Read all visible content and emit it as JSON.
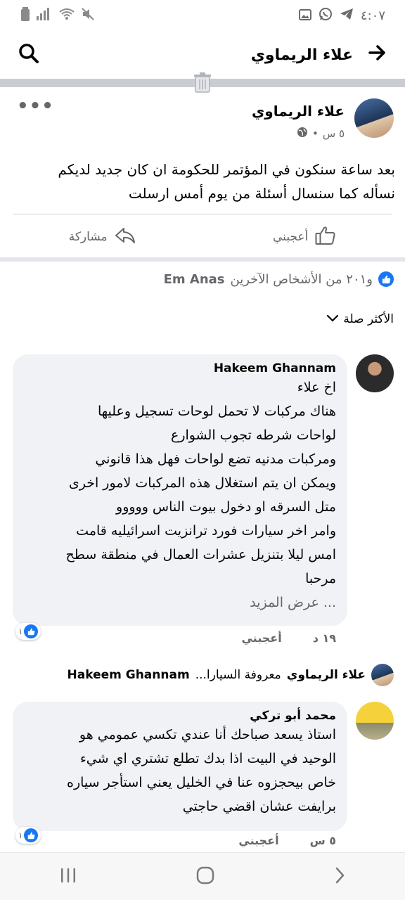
{
  "status_bar": {
    "time": "٤:٠٧",
    "left_icons": [
      "battery-icon",
      "signal-icon",
      "wifi-icon",
      "mute-icon"
    ],
    "right_icons": [
      "gallery-icon",
      "whatsapp-icon",
      "telegram-icon"
    ]
  },
  "header": {
    "title": "علاء الريماوي"
  },
  "post": {
    "author": "علاء الريماوي",
    "time": "٥ س",
    "dot": "•",
    "text_line1": "بعد ساعة سنكون في المؤتمر للحكومة ان كان جديد لديكم",
    "text_line2": "نسأله كما سنسال أسئلة من يوم أمس ارسلت",
    "more": "•••",
    "like_label": "أعجبني",
    "share_label": "مشاركة"
  },
  "reactions": {
    "names": "Em Anas",
    "others": "و٢٠١ من الأشخاص الآخرين"
  },
  "sort": {
    "label": "الأكثر صلة"
  },
  "comments": [
    {
      "name": "Hakeem Ghannam",
      "text": "اخ علاء\nهناك مركبات لا تحمل لوحات  تسجيل وعليها\nلواحات شرطه تجوب الشوارع\nومركبات مدنيه تضع لواحات فهل هذا قانوني\nويمكن ان يتم استغلال هذه المركبات لامور اخرى\nمتل السرقه او دخول بيوت الناس ووووو\nوامر اخر سيارات فورد ترانزيت اسرائيليه قامت\nامس ليلا بتنزيل عشرات العمال في منطقة سطح\nمرحبا",
      "see_more": "... عرض المزيد",
      "time": "١٩ د",
      "like_label": "أعجبني",
      "like_count": "١"
    },
    {
      "name": "محمد أبو تركي",
      "text": "استاذ يسعد صباحك أنا عندي تكسي عمومي هو\nالوحيد في البيت اذا بدك تطلع تشتري اي شيء\nخاص بيحجزوه  عنا في الخليل يعني استأجر سياره\nبرايفت عشان اقضي حاجتي",
      "time": "٥ س",
      "like_label": "أعجبني",
      "like_count": "١"
    }
  ],
  "reply_preview": {
    "author": "علاء الريماوي",
    "text": "معروفة السيارا...",
    "mention": "Hakeem Ghannam"
  },
  "colors": {
    "accent": "#1877f2",
    "bubble": "#f0f2f5",
    "secondary_text": "#65676b"
  }
}
